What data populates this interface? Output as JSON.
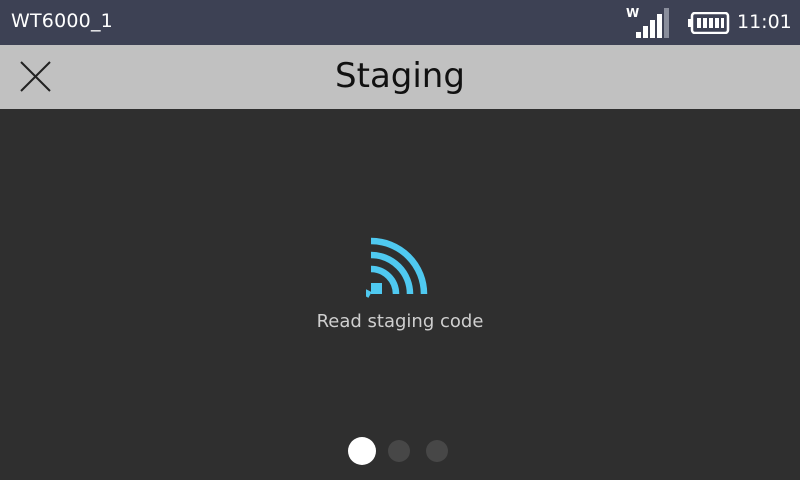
{
  "status_bar": {
    "device_name": "WT6000_1",
    "signal_label": "W",
    "signal_icon": "wifi-signal-icon",
    "battery_icon": "battery-full-icon",
    "time": "11:01"
  },
  "title_bar": {
    "close_icon": "close-icon",
    "title": "Staging"
  },
  "main": {
    "scan_icon": "nfc-wave-icon",
    "accent_color": "#4fc9f0",
    "instruction": "Read staging code"
  },
  "pager": {
    "page_count": 3,
    "active_page": 1
  }
}
